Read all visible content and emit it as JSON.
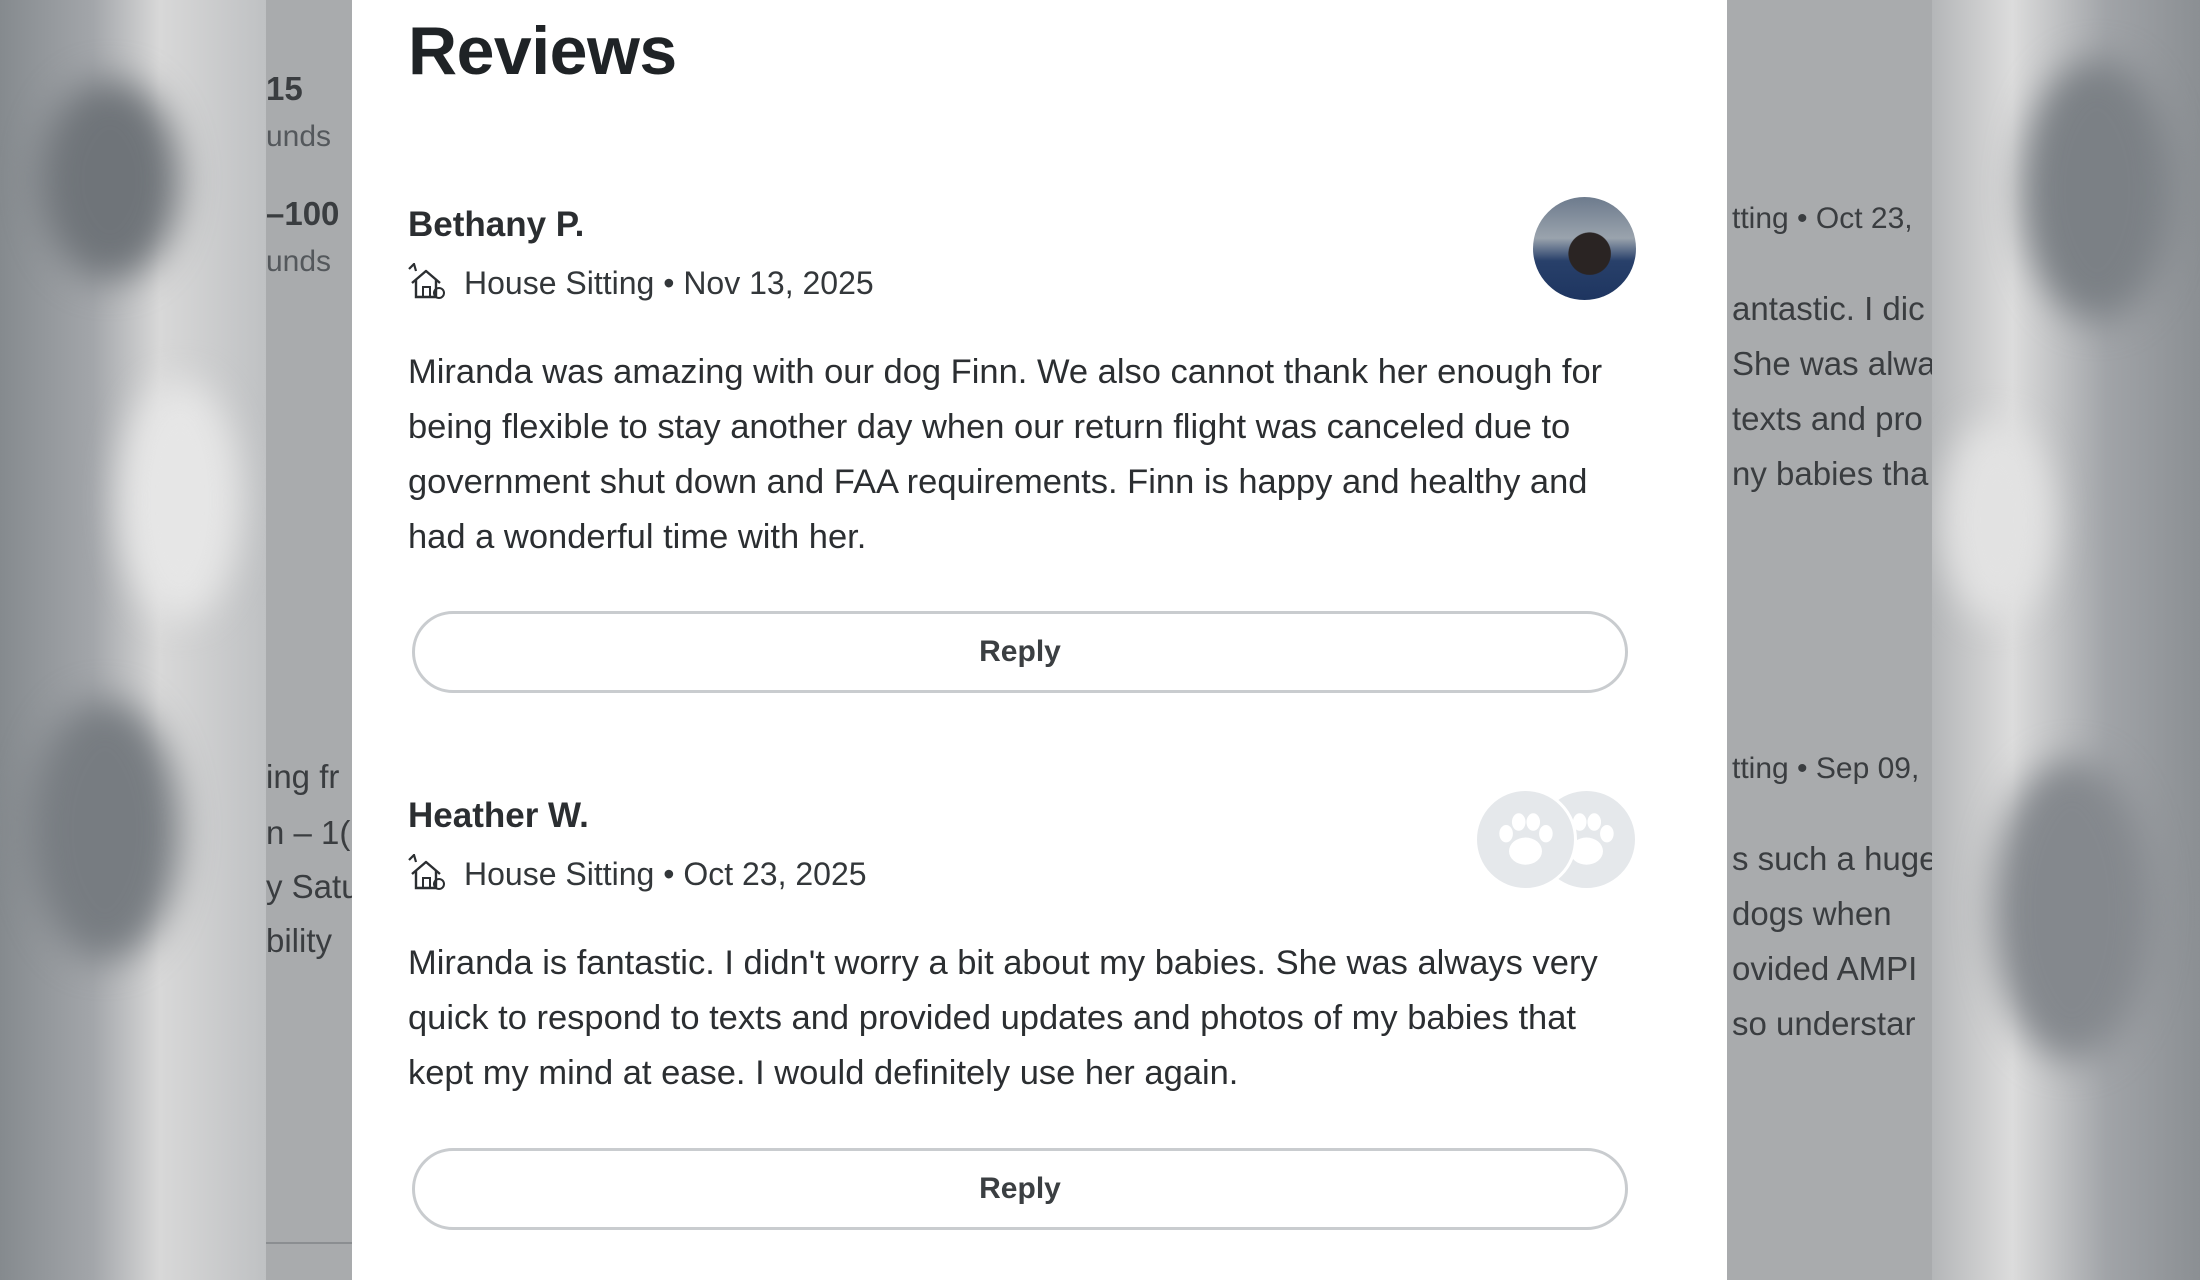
{
  "modal": {
    "title": "Reviews",
    "reviews": [
      {
        "name": "Bethany P.",
        "service": "House Sitting",
        "date": "Nov 13, 2025",
        "meta": "House Sitting • Nov 13, 2025",
        "body": "Miranda was amazing with our dog Finn. We also cannot thank her enough for being flexible to stay another day when our return flight was canceled due to government shut down and FAA requirements. Finn is happy and healthy and had a wonderful time with her.",
        "reply_label": "Reply",
        "avatar": "dog-photo"
      },
      {
        "name": "Heather W.",
        "service": "House Sitting",
        "date": "Oct 23, 2025",
        "meta": "House Sitting • Oct 23, 2025",
        "body": "Miranda is fantastic. I didn't worry a bit about my babies. She was always very quick to respond to texts and provided updates and photos of my babies that kept my mind at ease. I would definitely use her again.",
        "reply_label": "Reply",
        "avatar": "paw-placeholder"
      }
    ]
  },
  "background": {
    "left": {
      "stat1_value": "15",
      "stat1_unit": "unds",
      "stat2_value": "–100",
      "stat2_unit": "unds",
      "line1": "ing fr",
      "line2": "n – 1(",
      "line3": "y Satu",
      "line4": "bility"
    },
    "right": {
      "meta1": "tting • Oct 23,",
      "r1_line1": "antastic. I dic",
      "r1_line2": "She was alwa",
      "r1_line3": "texts and pro",
      "r1_line4": "ny babies tha",
      "meta2": "tting • Sep 09,",
      "r2_line1": "s such a huge",
      "r2_line2": " dogs when",
      "r2_line3": "ovided AMPI",
      "r2_line4": "so understar"
    }
  },
  "icons": [
    "house-sitting-icon",
    "scroll-up-arrow-icon",
    "paw-icon"
  ],
  "colors": {
    "overlay": "#a9abad",
    "modal_bg": "#ffffff",
    "text_dark": "#2b2e31",
    "button_border": "#c9cccf",
    "avatar_placeholder": "#e5e8eb"
  }
}
